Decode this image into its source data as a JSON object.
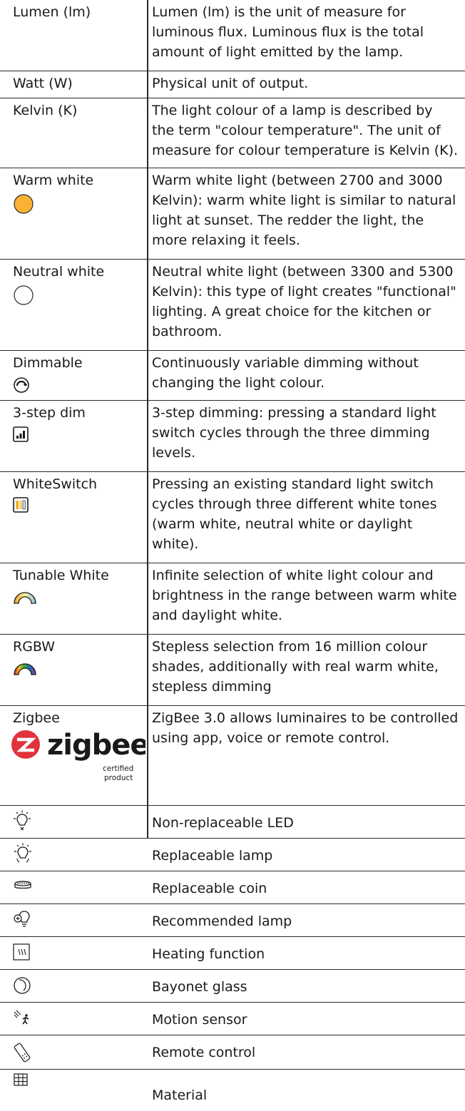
{
  "rows": [
    {
      "term": "Lumen (lm)",
      "desc": "Lumen (lm) is the unit of measure for luminous flux. Luminous flux is the total amount of light emitted by the lamp."
    },
    {
      "term": "Watt (W)",
      "desc": "Physical unit of output."
    },
    {
      "term": "Kelvin (K)",
      "desc": "The light colour of a lamp is described by the term \"colour temperature\". The unit of measure for colour temperature is Kelvin (K)."
    },
    {
      "term": "Warm white",
      "icon": "warm-white-circle-icon",
      "desc": "Warm white light (between 2700 and 3000 Kelvin): warm white light is similar to natural light at sunset. The redder the light, the more relaxing it feels."
    },
    {
      "term": "Neutral white",
      "icon": "neutral-white-circle-icon",
      "desc": "Neutral white light (between 3300 and 5300 Kelvin): this type of light creates \"functional\" lighting. A great choice for the kitchen or bathroom."
    },
    {
      "term": "Dimmable",
      "icon": "dimmable-icon",
      "desc": "Continuously variable dimming without changing the light colour."
    },
    {
      "term": "3-step dim",
      "icon": "three-step-dim-icon",
      "desc": "3-step dimming: pressing a standard light switch cycles through the three dimming levels."
    },
    {
      "term": "WhiteSwitch",
      "icon": "whiteswitch-icon",
      "desc": "Pressing an existing standard light switch cycles through three different white tones (warm white, neutral white or daylight white)."
    },
    {
      "term": "Tunable White",
      "icon": "tunable-white-icon",
      "desc": "Infinite selection of white light colour and brightness in the range between warm white and daylight white."
    },
    {
      "term": "RGBW",
      "icon": "rgbw-icon",
      "desc": "Stepless selection from 16 million colour shades, additionally with real warm white, stepless dimming"
    },
    {
      "term": "Zigbee",
      "icon": "zigbee-logo",
      "logo_text": "zigbee",
      "logo_sub1": "certified",
      "logo_sub2": "product",
      "desc": "ZigBee 3.0 allows luminaires to be controlled using app, voice or remote control."
    }
  ],
  "icon_rows": [
    {
      "icon": "non-replaceable-led-icon",
      "desc": "Non-replaceable LED"
    },
    {
      "icon": "replaceable-lamp-icon",
      "desc": "Replaceable lamp"
    },
    {
      "icon": "replaceable-coin-icon",
      "desc": "Replaceable coin"
    },
    {
      "icon": "recommended-lamp-icon",
      "desc": "Recommended lamp"
    },
    {
      "icon": "heating-function-icon",
      "desc": "Heating function"
    },
    {
      "icon": "bayonet-glass-icon",
      "desc": "Bayonet glass"
    },
    {
      "icon": "motion-sensor-icon",
      "desc": "Motion sensor"
    },
    {
      "icon": "remote-control-icon",
      "desc": "Remote control"
    },
    {
      "icon": "material-icon",
      "desc": "Material"
    }
  ],
  "colors": {
    "warm_white": "#f9b233",
    "zigbee_red": "#e1333b",
    "whiteswitch_1": "#f5a623",
    "whiteswitch_2": "#f7d15a",
    "whiteswitch_3": "#c9dff5"
  }
}
